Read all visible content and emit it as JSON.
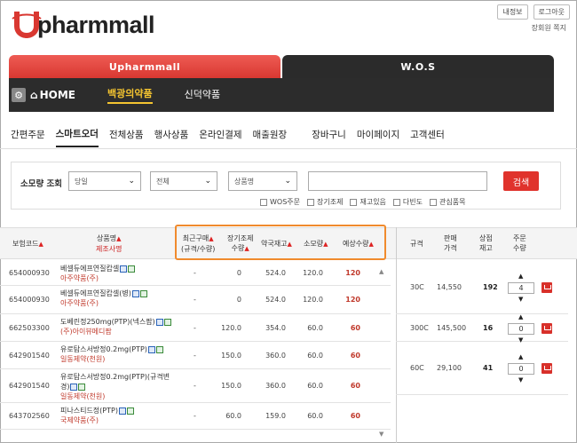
{
  "header": {
    "logo_text": "pharmmall",
    "buttons": [
      "내정보",
      "로그아웃"
    ],
    "links": "장회원  쪽지"
  },
  "tabs": {
    "left": "Upharmmall",
    "right": "W.O.S"
  },
  "nav": {
    "home": "HOME",
    "items": [
      "백광의약품",
      "신덕약품"
    ]
  },
  "menu": [
    "간편주문",
    "스마트오더",
    "전체상품",
    "행사상품",
    "온라인결제",
    "매출원장",
    "장바구니",
    "마이페이지",
    "고객센터"
  ],
  "search": {
    "label": "소모량 조회",
    "selects": [
      "당일",
      "전체",
      "상품명"
    ],
    "button": "검색",
    "checks": [
      "WOS주문",
      "장기조제",
      "재고있음",
      "다빈도",
      "관심품목"
    ]
  },
  "table": {
    "headers": {
      "code": "보험코드",
      "name": "상품명",
      "maker": "제조사명",
      "recent1": "최근구매",
      "recent2": "(규격/수량)",
      "long1": "장기조제",
      "long2": "수량",
      "stock": "약국재고",
      "consume": "소모량",
      "expected": "예상수량",
      "spec": "규격",
      "price1": "판매",
      "price2": "가격",
      "mstock1": "상점",
      "mstock2": "재고",
      "oqty1": "주문",
      "oqty2": "수량"
    },
    "rows": [
      {
        "code": "654000930",
        "name": "베셀듀에프연질캅셀",
        "maker": "아주약품(주)",
        "recent": "-",
        "long": "0",
        "stock": "524.0",
        "consume": "120.0",
        "expected": "120"
      },
      {
        "code": "654000930",
        "name": "베셀듀에프연질캅셀(병)",
        "maker": "아주약품(주)",
        "recent": "-",
        "long": "0",
        "stock": "524.0",
        "consume": "120.0",
        "expected": "120"
      },
      {
        "code": "662503300",
        "name": "도베린정250mg(PTP)(넥스팜)",
        "maker": "(주)아이뷰메디팜",
        "recent": "-",
        "long": "120.0",
        "stock": "354.0",
        "consume": "60.0",
        "expected": "60"
      },
      {
        "code": "642901540",
        "name": "유로탐스서방정0.2mg(PTP)",
        "maker": "일동제약(천원)",
        "recent": "-",
        "long": "150.0",
        "stock": "360.0",
        "consume": "60.0",
        "expected": "60"
      },
      {
        "code": "642901540",
        "name": "유로탐스서방정0.2mg(PTP)(규격변경)",
        "maker": "일동제약(천원)",
        "recent": "-",
        "long": "150.0",
        "stock": "360.0",
        "consume": "60.0",
        "expected": "60"
      },
      {
        "code": "643702560",
        "name": "피나스티드정(PTP)",
        "maker": "국제약품(주)",
        "recent": "-",
        "long": "60.0",
        "stock": "159.0",
        "consume": "60.0",
        "expected": "60"
      }
    ],
    "right_rows": [
      {
        "spec": "30C",
        "price": "14,550",
        "mstock": "192",
        "qty": "4"
      },
      {
        "spec": "300C",
        "price": "145,500",
        "mstock": "16",
        "qty": "0"
      },
      {
        "spec": "60C",
        "price": "29,100",
        "mstock": "41",
        "qty": "0"
      }
    ]
  },
  "colors": {
    "accent_red": "#e0332c",
    "nav_dark": "#2c2c2c",
    "active_yellow": "#f4c430",
    "highlight_orange": "#f08a2d"
  }
}
